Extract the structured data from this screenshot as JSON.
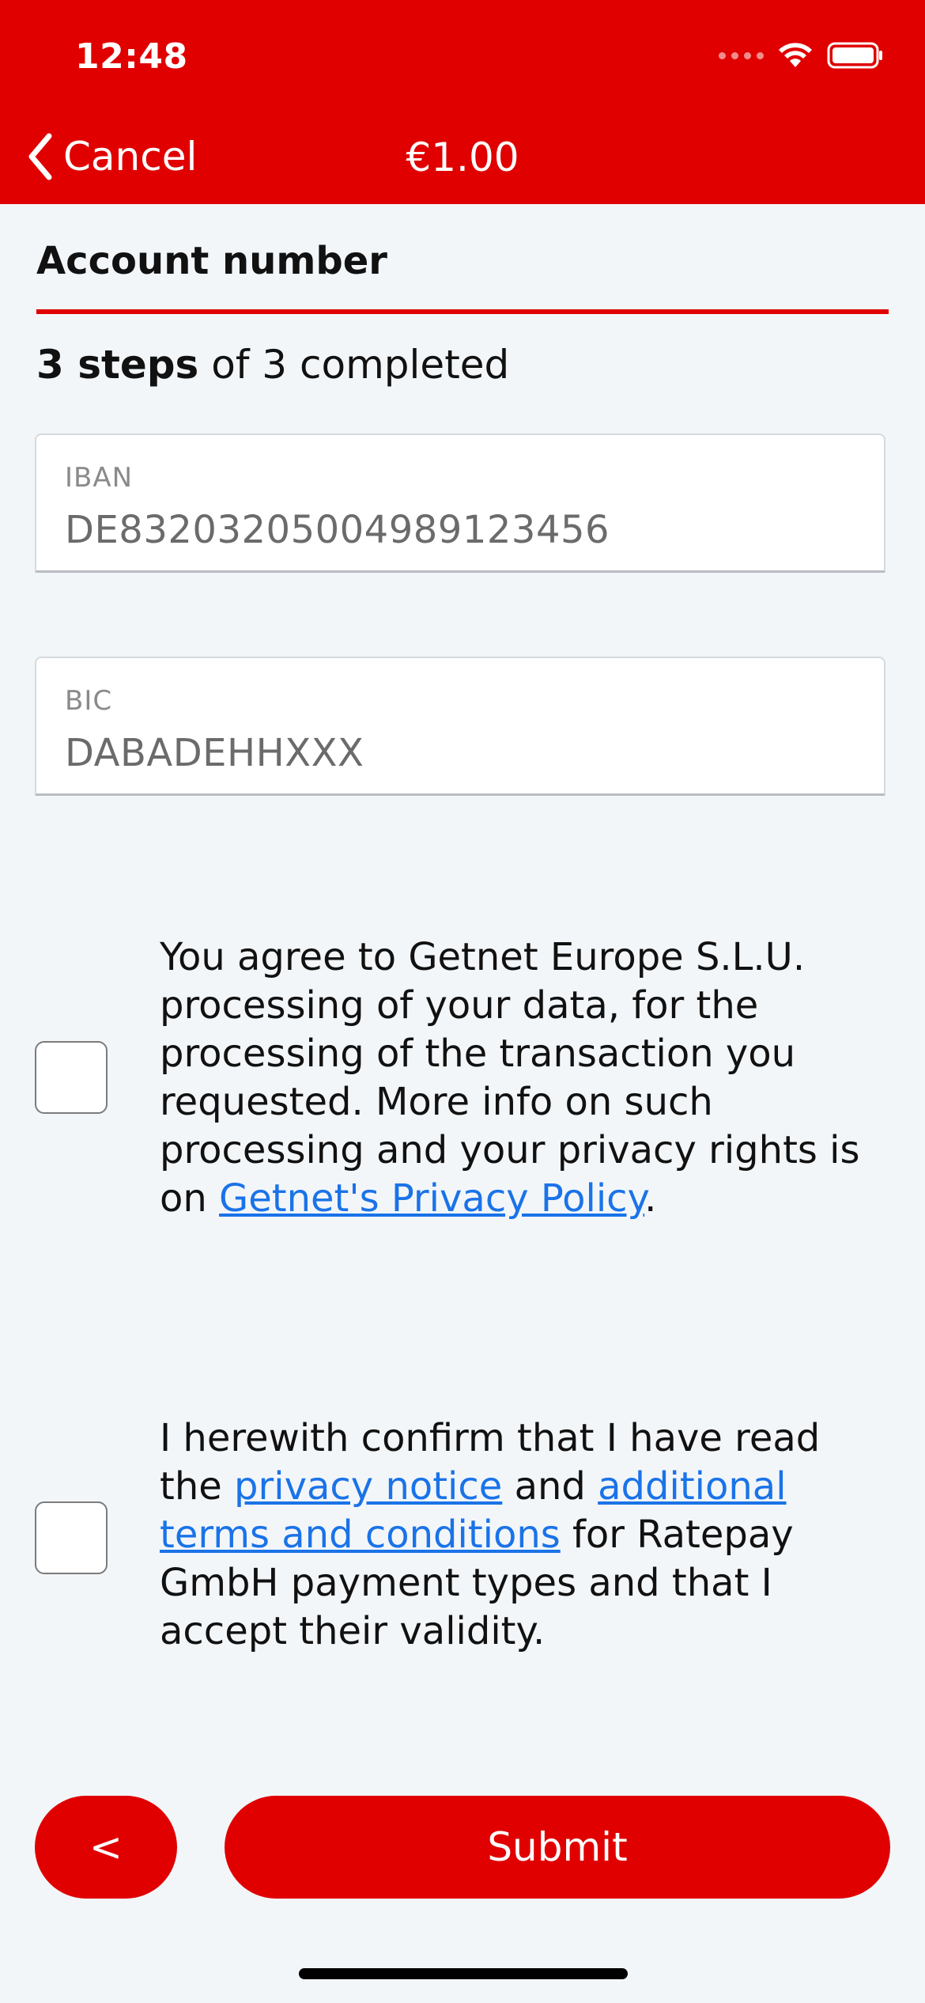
{
  "status_bar": {
    "time": "12:48"
  },
  "nav": {
    "back_label": "Cancel",
    "title": "€1.00"
  },
  "section": {
    "title": "Account number",
    "steps_bold": "3 steps",
    "steps_rest": " of 3 completed"
  },
  "fields": {
    "iban": {
      "label": "IBAN",
      "value": "DE83203205004989123456"
    },
    "bic": {
      "label": "BIC",
      "value": "DABADEHHXXX"
    }
  },
  "consent1": {
    "text_before": "You agree to Getnet Europe S.L.U. processing of your data, for the processing of the transaction you requested. More info on such processing and your privacy rights is on ",
    "link": "Getnet's Privacy Policy",
    "text_after": ".",
    "checked": false
  },
  "consent2": {
    "text_a": "I herewith confirm that I have read the ",
    "link1": "privacy notice",
    "text_b": " and ",
    "link2": "additional terms and conditions",
    "text_c": " for Ratepay GmbH payment types and that I accept their validity.",
    "checked": false
  },
  "buttons": {
    "back_label": "<",
    "submit_label": "Submit"
  },
  "colors": {
    "brand_red": "#E00000",
    "link_blue": "#1A73E8",
    "background": "#F3F6F9"
  },
  "icons": {
    "back": "chevron-left-icon",
    "wifi": "wifi-icon",
    "battery": "battery-icon",
    "signal": "signal-dots-icon"
  }
}
